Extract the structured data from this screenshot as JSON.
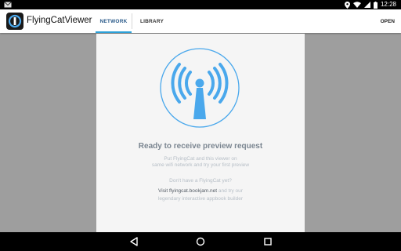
{
  "status_bar": {
    "time": "12:28",
    "icons": [
      "gmail-icon",
      "location-icon",
      "wifi-icon",
      "cell-signal-icon",
      "battery-icon"
    ]
  },
  "app_bar": {
    "title": "FlyingCatViewer",
    "icon": "app-logo-icon",
    "tabs": [
      {
        "label": "NETWORK",
        "selected": true
      },
      {
        "label": "LIBRARY",
        "selected": false
      }
    ],
    "action_label": "OPEN"
  },
  "main": {
    "graphic_icon": "wifi-antenna-icon",
    "headline": "Ready to receive preview request",
    "instructions_line1": "Put FlyingCat and this viewer on",
    "instructions_line2": "same wifi network and try your first preview",
    "question": "Don't have a FlyingCat yet?",
    "visit_prefix": "Visit ",
    "visit_link": "flyingcat.bookjam.net",
    "visit_suffix": " and try our",
    "visit_line2": "legendary interactive appbook builder"
  },
  "nav_bar": {
    "icons": [
      "back-icon",
      "home-icon",
      "recents-icon"
    ]
  },
  "colors": {
    "accent": "#2aa0d8",
    "wifi_blue": "#4aa8ec",
    "headline": "#7a8590",
    "subtext": "#b6bec6",
    "background": "#9e9e9e",
    "card": "#f5f5f5"
  }
}
